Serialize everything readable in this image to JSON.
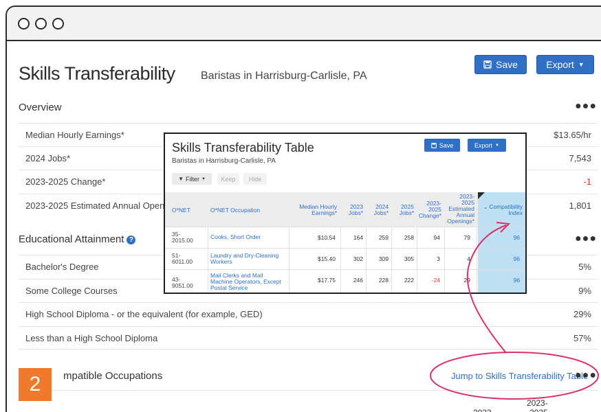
{
  "window": {
    "title": "Skills Transferability",
    "subtitle": "Baristas in Harrisburg-Carlisle, PA",
    "save_label": "Save",
    "export_label": "Export"
  },
  "overview": {
    "title": "Overview",
    "rows": [
      {
        "label": "Median Hourly Earnings*",
        "value": "$13.65/hr"
      },
      {
        "label": "2024 Jobs*",
        "value": "7,543"
      },
      {
        "label": "2023-2025 Change*",
        "value": "-1"
      },
      {
        "label": "2023-2025 Estimated Annual Openin",
        "value": "1,801"
      }
    ]
  },
  "education": {
    "title": "Educational Attainment",
    "rows": [
      {
        "label": "Bachelor's Degree",
        "value": "5%"
      },
      {
        "label": "Some College Courses",
        "value": "9%"
      },
      {
        "label": "High School Diploma - or the equivalent (for example, GED)",
        "value": "29%"
      },
      {
        "label": "Less than a High School Diploma",
        "value": "57%"
      }
    ]
  },
  "compatible": {
    "title": "mpatible Occupations",
    "jump_link": "Jump to Skills Transferability Table",
    "partial_header": "2023-",
    "partial_header_2": "2025",
    "partial_header_3": "2023"
  },
  "badge": {
    "number": "2"
  },
  "overlay": {
    "title": "Skills Transferability Table",
    "subtitle": "Baristas in Harrisburg-Carlisle, PA",
    "save_label": "Save",
    "export_label": "Export",
    "filter_label": "Filter",
    "keep_label": "Keep",
    "hide_label": "Hide",
    "headers": {
      "onet": "O*NET",
      "occupation": "O*NET Occupation",
      "earnings_1": "Median Hourly",
      "earnings_2": "Earnings*",
      "jobs2023_1": "2023",
      "jobs2023_2": "Jobs*",
      "jobs2024_1": "2024",
      "jobs2024_2": "Jobs*",
      "jobs2025_1": "2025",
      "jobs2025_2": "Jobs*",
      "change_1": "2023-",
      "change_2": "2025",
      "change_3": "Change*",
      "openings_1": "2023-",
      "openings_2": "2025",
      "openings_3": "Estimated",
      "openings_4": "Annual",
      "openings_5": "Openings*",
      "compat_1": "Compatibility",
      "compat_2": "Index"
    },
    "rows": [
      {
        "code_1": "35-",
        "code_2": "2015.00",
        "occ_1": "Cooks, Short Order",
        "occ_2": "",
        "occ_3": "",
        "earnings": "$10.54",
        "j23": "164",
        "j24": "259",
        "j25": "258",
        "change": "94",
        "openings": "79",
        "compat": "96"
      },
      {
        "code_1": "51-",
        "code_2": "6011.00",
        "occ_1": "Laundry and Dry-Cleaning",
        "occ_2": "Workers",
        "occ_3": "",
        "earnings": "$15.40",
        "j23": "302",
        "j24": "309",
        "j25": "305",
        "change": "3",
        "openings": "4",
        "compat": "96"
      },
      {
        "code_1": "43-",
        "code_2": "9051.00",
        "occ_1": "Mail Clerks and Mail",
        "occ_2": "Machine Operators, Except",
        "occ_3": "Postal Service",
        "earnings": "$17.75",
        "j23": "246",
        "j24": "228",
        "j25": "222",
        "change": "-24",
        "openings": "29",
        "compat": "96"
      }
    ]
  },
  "colors": {
    "accent": "#2f6fc4",
    "negative": "#e04040",
    "badge": "#f07a2c",
    "annotation": "#d8306a",
    "highlight": "#bfe0f3"
  }
}
